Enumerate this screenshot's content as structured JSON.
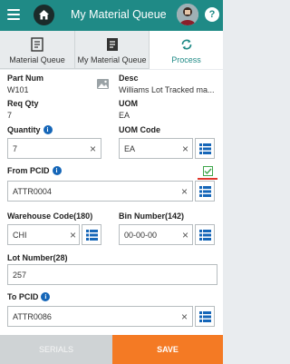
{
  "header": {
    "title": "My Material Queue"
  },
  "tabs": [
    {
      "label": "Material Queue",
      "active": false
    },
    {
      "label": "My Material Queue",
      "active": false
    },
    {
      "label": "Process",
      "active": true
    }
  ],
  "details": {
    "part_num_label": "Part Num",
    "part_num_value": "W101",
    "desc_label": "Desc",
    "desc_value": "Williams Lot Tracked ma...",
    "req_qty_label": "Req Qty",
    "req_qty_value": "7",
    "uom_label": "UOM",
    "uom_value": "EA"
  },
  "form": {
    "quantity_label": "Quantity",
    "quantity_value": "7",
    "uom_code_label": "UOM Code",
    "uom_code_value": "EA",
    "from_pcid_label": "From PCID",
    "from_pcid_value": "ATTR0004",
    "warehouse_label": "Warehouse Code(180)",
    "warehouse_value": "CHI",
    "bin_label": "Bin Number(142)",
    "bin_value": "00-00-00",
    "lot_label": "Lot Number(28)",
    "lot_value": "257",
    "to_pcid_label": "To PCID",
    "to_pcid_value": "ATTR0086"
  },
  "actions": {
    "serials_label": "SERIALS",
    "save_label": "SAVE"
  },
  "colors": {
    "header": "#1f8a86",
    "accent": "#1566b8",
    "save": "#f47a24"
  },
  "icons": [
    "menu-icon",
    "home-icon",
    "help-icon",
    "list-icon",
    "image-icon",
    "checkbox-icon",
    "info-icon"
  ]
}
